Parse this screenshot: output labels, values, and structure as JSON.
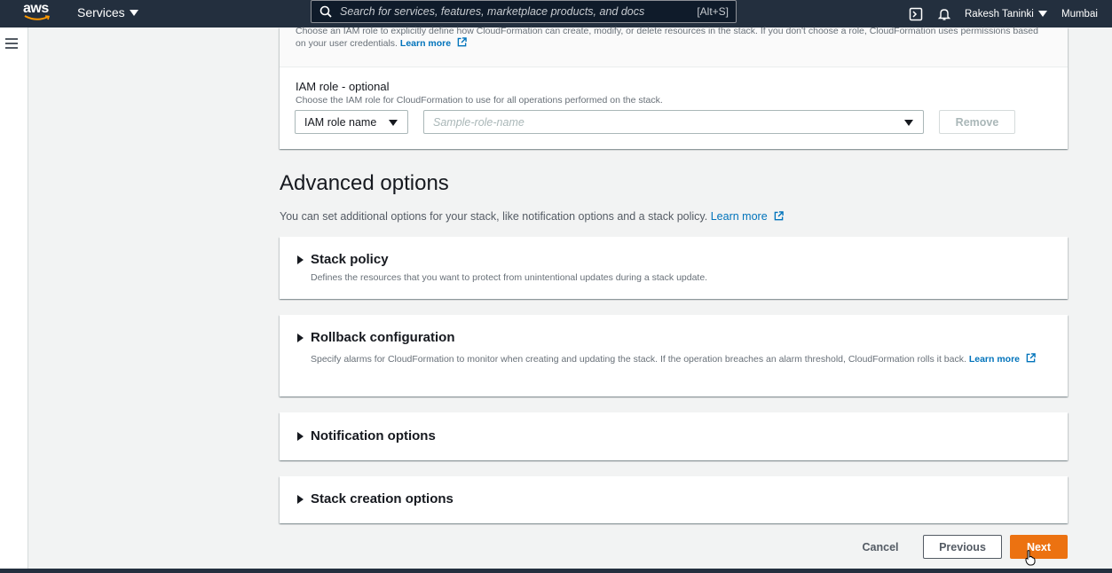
{
  "nav": {
    "logo_text": "aws",
    "services_label": "Services",
    "search_placeholder": "Search for services, features, marketplace products, and docs",
    "search_shortcut": "[Alt+S]",
    "user_name": "Rakesh Taninki",
    "region": "Mumbai"
  },
  "permissions": {
    "description": "Choose an IAM role to explicitly define how CloudFormation can create, modify, or delete resources in the stack. If you don't choose a role, CloudFormation uses permissions based on your user credentials.",
    "learn_more": "Learn more",
    "iam_role_label": "IAM role - optional",
    "iam_role_description": "Choose the IAM role for CloudFormation to use for all operations performed on the stack.",
    "iam_role_type_selected": "IAM role name",
    "role_name_placeholder": "Sample-role-name",
    "remove_label": "Remove"
  },
  "advanced": {
    "title": "Advanced options",
    "description": "You can set additional options for your stack, like notification options and a stack policy.",
    "learn_more": "Learn more",
    "sections": [
      {
        "title": "Stack policy",
        "description": "Defines the resources that you want to protect from unintentional updates during a stack update."
      },
      {
        "title": "Rollback configuration",
        "description": "Specify alarms for CloudFormation to monitor when creating and updating the stack. If the operation breaches an alarm threshold, CloudFormation rolls it back.",
        "learn_more": "Learn more"
      },
      {
        "title": "Notification options"
      },
      {
        "title": "Stack creation options"
      }
    ]
  },
  "footer": {
    "cancel_label": "Cancel",
    "previous_label": "Previous",
    "next_label": "Next"
  },
  "colors": {
    "nav_bg": "#232f3e",
    "primary": "#ec7211",
    "link": "#0073bb"
  }
}
